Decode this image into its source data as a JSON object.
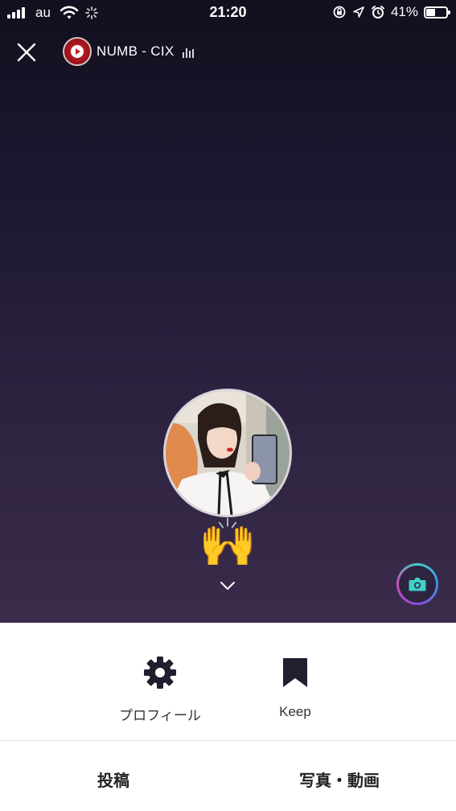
{
  "status_bar": {
    "carrier": "au",
    "time": "21:20",
    "battery_percent": "41%",
    "battery_level": 0.41,
    "icons": [
      "signal-icon",
      "wifi-icon",
      "loading-spinner-icon",
      "rotation-lock-icon",
      "location-arrow-icon",
      "alarm-icon",
      "battery-icon"
    ]
  },
  "header": {
    "close_icon": "close-icon",
    "music_title": "NUMB - CIX",
    "music_icon": "play-disc-icon",
    "equalizer_icon": "equalizer-icon"
  },
  "profile": {
    "avatar": "profile-photo",
    "status_emoji": "🙌",
    "expand_icon": "chevron-down-icon",
    "camera_icon": "camera-icon"
  },
  "actions": {
    "profile_label": "プロフィール",
    "profile_icon": "gear-icon",
    "keep_label": "Keep",
    "keep_icon": "bookmark-icon"
  },
  "tabs": {
    "posts_label": "投稿",
    "media_label": "写真・動画"
  },
  "colors": {
    "hero_top": "#120f1e",
    "hero_bottom": "#3a2c4a",
    "camera_accent": "#3fd1c6",
    "disc_red": "#d8232a"
  }
}
